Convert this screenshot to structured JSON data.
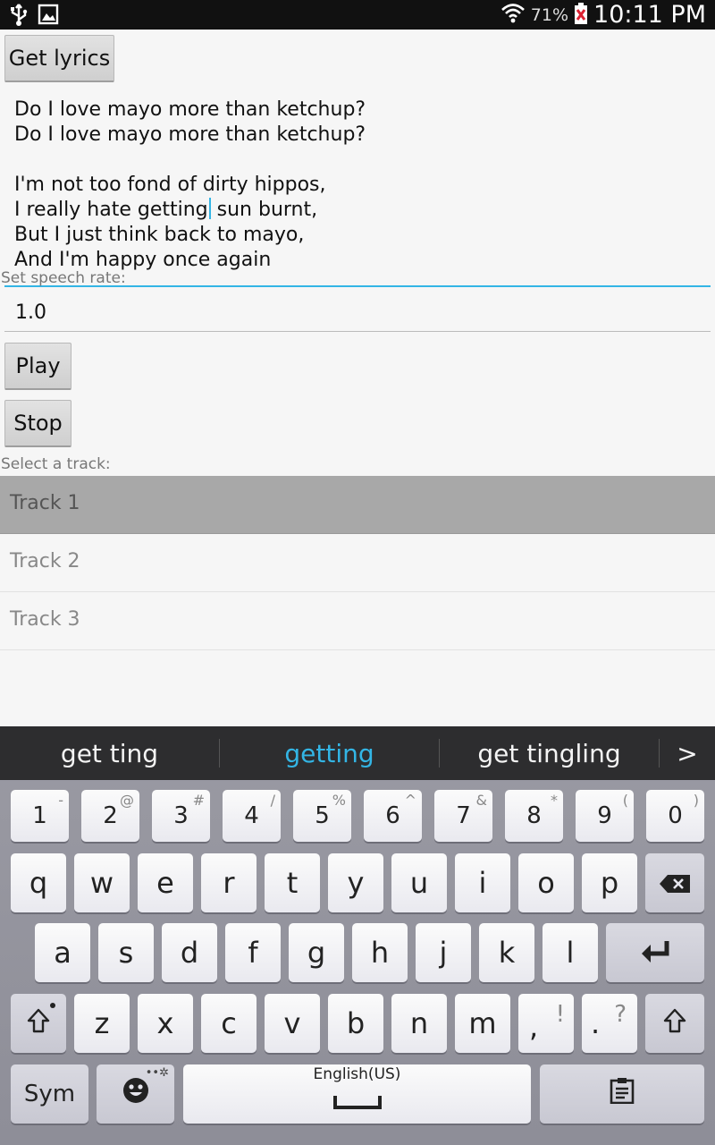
{
  "status_bar": {
    "battery_percent": "71%",
    "time": "10:11 PM",
    "icons": [
      "usb-icon",
      "image-icon",
      "wifi-icon",
      "battery-icon"
    ]
  },
  "app": {
    "get_lyrics_label": "Get lyrics",
    "lyrics_before_cursor": "Do I love mayo more than ketchup?\nDo I love mayo more than ketchup?\n\nI'm not too fond of dirty hippos,\nI really hate getting",
    "lyrics_after_cursor": " sun burnt,\nBut I just think back to mayo,\nAnd I'm happy once again",
    "speech_rate_label": "Set speech rate:",
    "speech_rate_value": "1.0",
    "play_label": "Play",
    "stop_label": "Stop",
    "select_track_label": "Select a track:",
    "tracks": [
      "Track 1",
      "Track 2",
      "Track 3"
    ],
    "selected_track": "Track 1"
  },
  "keyboard": {
    "suggestions": [
      "get ting",
      "getting",
      "get tingling"
    ],
    "more_suggestions": ">",
    "number_row": [
      {
        "main": "1",
        "sub": "-"
      },
      {
        "main": "2",
        "sub": "@"
      },
      {
        "main": "3",
        "sub": "#"
      },
      {
        "main": "4",
        "sub": "/"
      },
      {
        "main": "5",
        "sub": "%"
      },
      {
        "main": "6",
        "sub": "^"
      },
      {
        "main": "7",
        "sub": "&"
      },
      {
        "main": "8",
        "sub": "*"
      },
      {
        "main": "9",
        "sub": "("
      },
      {
        "main": "0",
        "sub": ")"
      }
    ],
    "row1": [
      "q",
      "w",
      "e",
      "r",
      "t",
      "y",
      "u",
      "i",
      "o",
      "p"
    ],
    "row2": [
      "a",
      "s",
      "d",
      "f",
      "g",
      "h",
      "j",
      "k",
      "l"
    ],
    "row3": [
      "z",
      "x",
      "c",
      "v",
      "b",
      "n",
      "m"
    ],
    "comma_key": {
      "main": ",",
      "sub": "!"
    },
    "period_key": {
      "main": ".",
      "sub": "?"
    },
    "sym_label": "Sym",
    "space_label": "English(US)",
    "accent_color": "#33b5e5"
  }
}
